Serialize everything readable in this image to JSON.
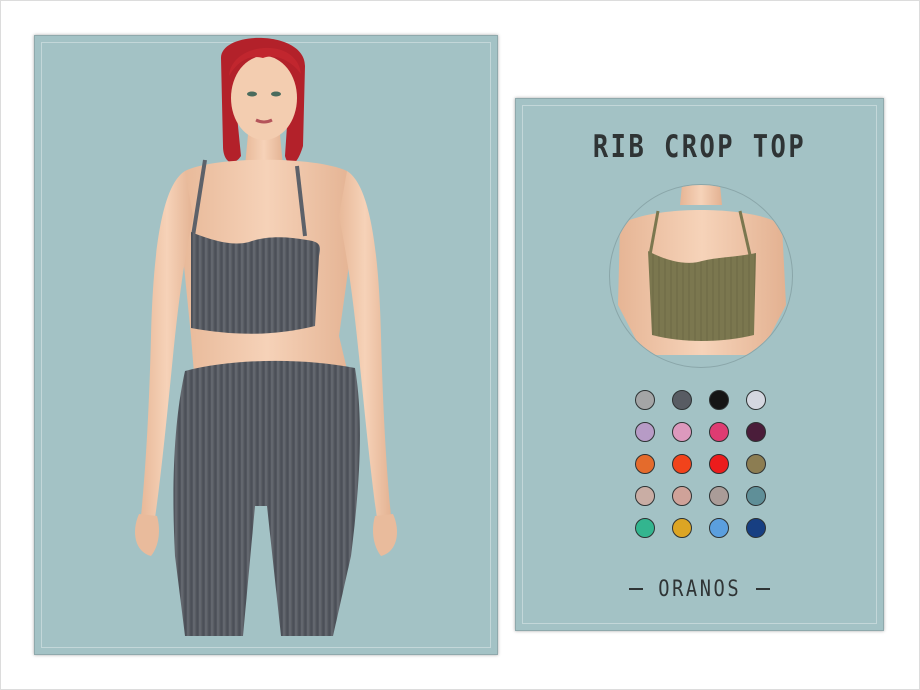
{
  "card": {
    "title": "RIB CROP TOP",
    "author": "ORANOS"
  },
  "swatches": [
    {
      "name": "light-gray",
      "color": "#a4a5a6"
    },
    {
      "name": "dark-gray",
      "color": "#585c63"
    },
    {
      "name": "black",
      "color": "#151515"
    },
    {
      "name": "pale-lavender-gray",
      "color": "#d4d7e0"
    },
    {
      "name": "lavender",
      "color": "#b79bc6"
    },
    {
      "name": "light-pink",
      "color": "#dc99bd"
    },
    {
      "name": "hot-pink",
      "color": "#de3c72"
    },
    {
      "name": "plum",
      "color": "#4a1d3a"
    },
    {
      "name": "orange",
      "color": "#e46b2c"
    },
    {
      "name": "red-orange",
      "color": "#f1431b"
    },
    {
      "name": "red",
      "color": "#ec1c1c"
    },
    {
      "name": "olive",
      "color": "#8c7d52"
    },
    {
      "name": "beige",
      "color": "#c9ada4"
    },
    {
      "name": "dusty-rose",
      "color": "#cfa299"
    },
    {
      "name": "taupe",
      "color": "#aa9c98"
    },
    {
      "name": "teal-gray",
      "color": "#5f8f98"
    },
    {
      "name": "mint-green",
      "color": "#33b58f"
    },
    {
      "name": "mustard",
      "color": "#dca524"
    },
    {
      "name": "sky-blue",
      "color": "#5b9fde"
    },
    {
      "name": "navy",
      "color": "#173f82"
    }
  ],
  "colors": {
    "panel": "#a3c2c5",
    "top_on_model": "#5d6169",
    "top_in_preview": "#7d7850",
    "skin": "#f1c8ab",
    "hair": "#b7222a"
  }
}
